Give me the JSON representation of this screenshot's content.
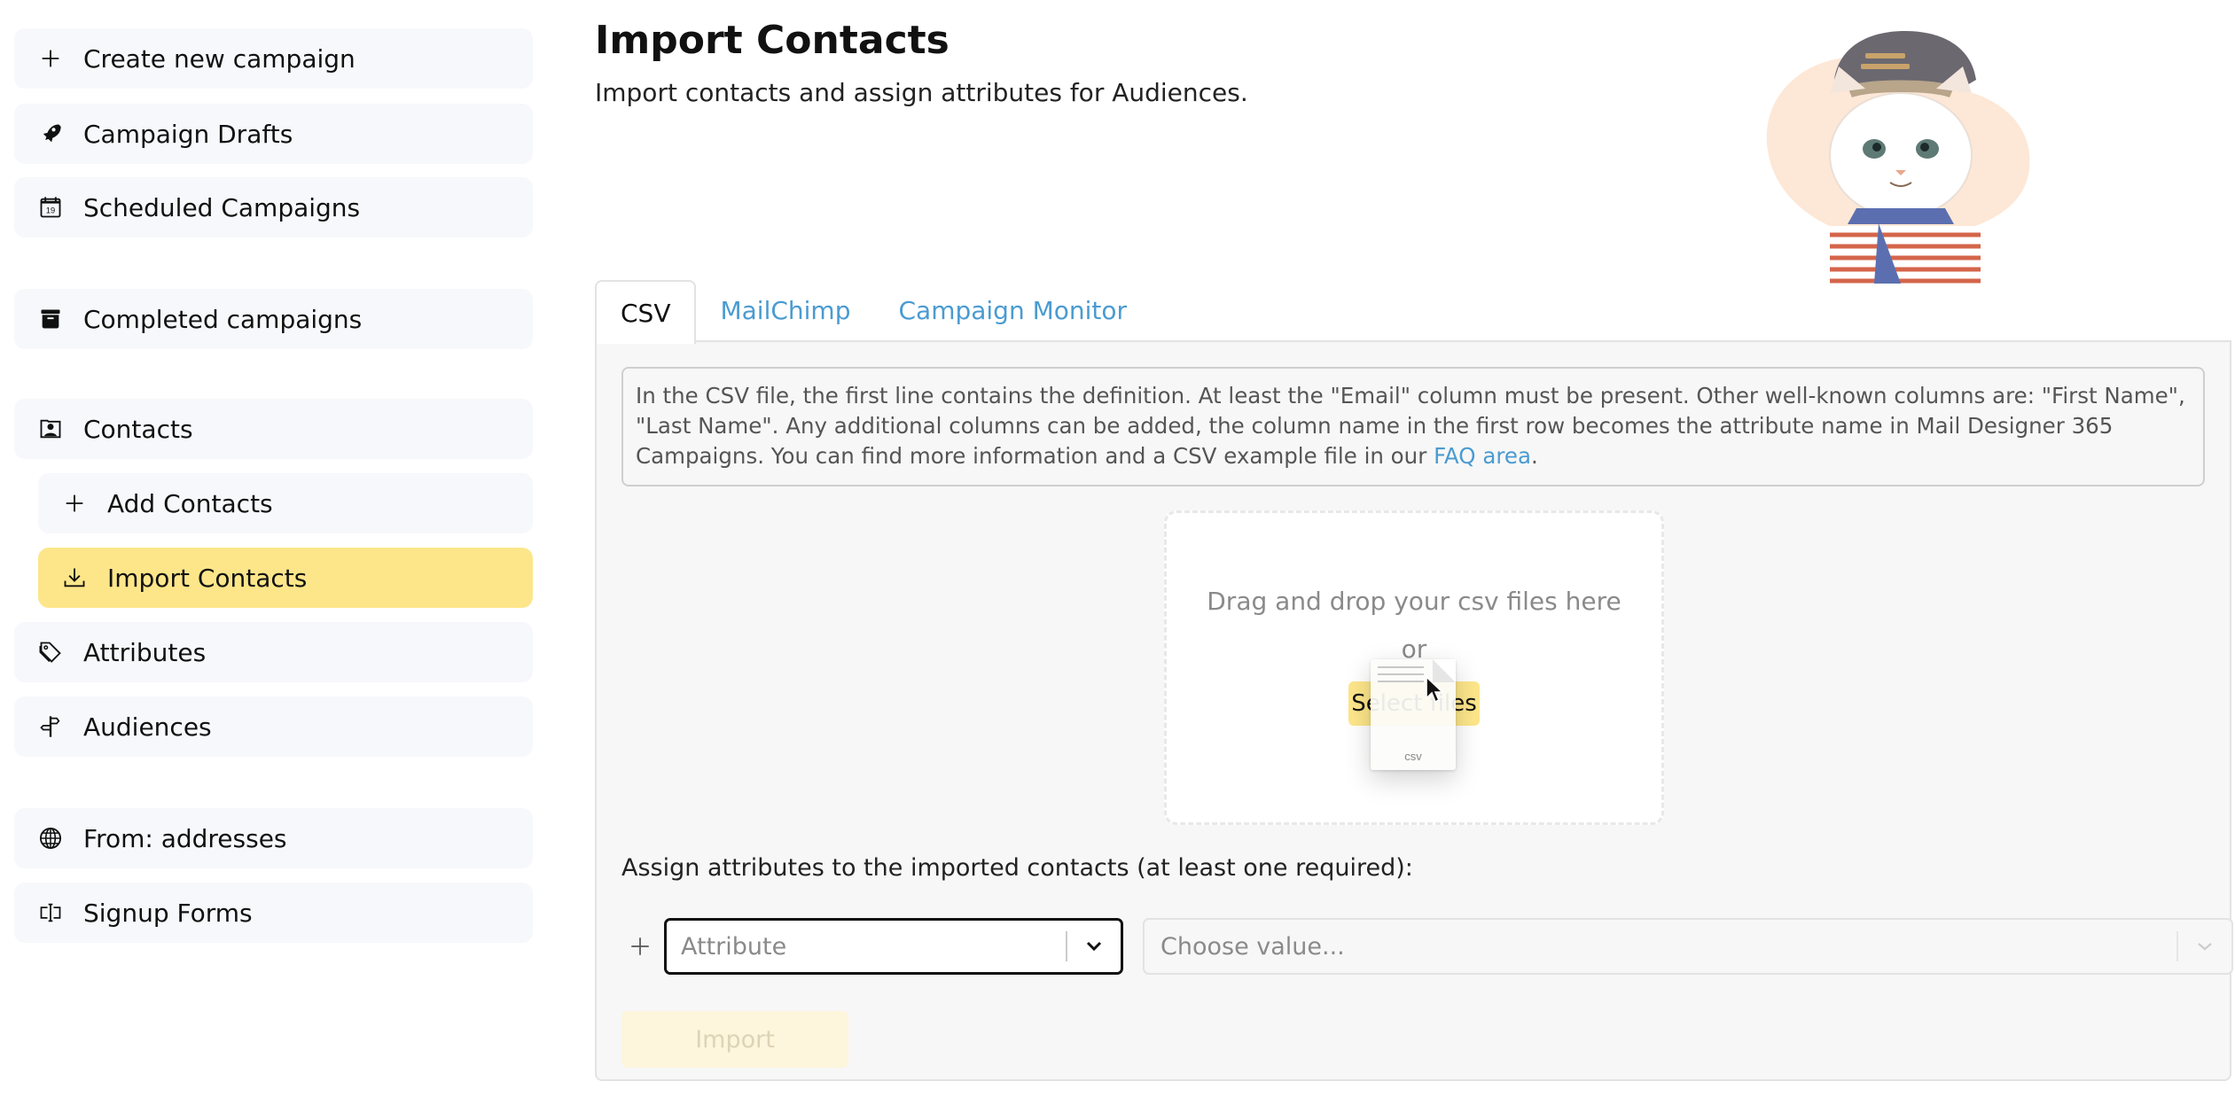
{
  "sidebar": {
    "items": [
      {
        "label": "Create new campaign",
        "icon": "plus-icon"
      },
      {
        "label": "Campaign Drafts",
        "icon": "rocket-icon"
      },
      {
        "label": "Scheduled Campaigns",
        "icon": "calendar-icon",
        "icon_text": "19"
      },
      {
        "label": "Completed campaigns",
        "icon": "archive-icon"
      },
      {
        "label": "Contacts",
        "icon": "contact-card-icon"
      },
      {
        "label": "Add Contacts",
        "icon": "plus-icon"
      },
      {
        "label": "Import Contacts",
        "icon": "download-icon",
        "active": true
      },
      {
        "label": "Attributes",
        "icon": "tags-icon"
      },
      {
        "label": "Audiences",
        "icon": "signpost-icon"
      },
      {
        "label": "From: addresses",
        "icon": "globe-icon"
      },
      {
        "label": "Signup Forms",
        "icon": "input-cursor-icon"
      }
    ]
  },
  "header": {
    "title": "Import Contacts",
    "subtitle": "Import contacts and assign attributes for Audiences."
  },
  "tabs": [
    {
      "label": "CSV",
      "active": true
    },
    {
      "label": "MailChimp",
      "active": false
    },
    {
      "label": "Campaign Monitor",
      "active": false
    }
  ],
  "info": {
    "text_before_link": "In the CSV file, the first line contains the definition. At least the \"Email\" column must be present. Other well-known columns are: \"First Name\", \"Last Name\". Any additional columns can be added, the column name in the first row becomes the attribute name in Mail Designer 365 Campaigns. You can find more information and a CSV example file in our ",
    "link_text": "FAQ area",
    "text_after_link": "."
  },
  "dropzone": {
    "text": "Drag and drop your csv files here",
    "or": "or",
    "select_button": "Select files",
    "dragged_file_ext": "csv"
  },
  "assign": {
    "label": "Assign attributes to the imported contacts (at least one required):",
    "attribute_placeholder": "Attribute",
    "value_placeholder": "Choose value..."
  },
  "import_button": "Import",
  "colors": {
    "accent_yellow": "#fde68a",
    "link_blue": "#4a9bd1",
    "sidebar_bg": "#f7f8fb",
    "panel_bg": "#f7f7f7"
  }
}
